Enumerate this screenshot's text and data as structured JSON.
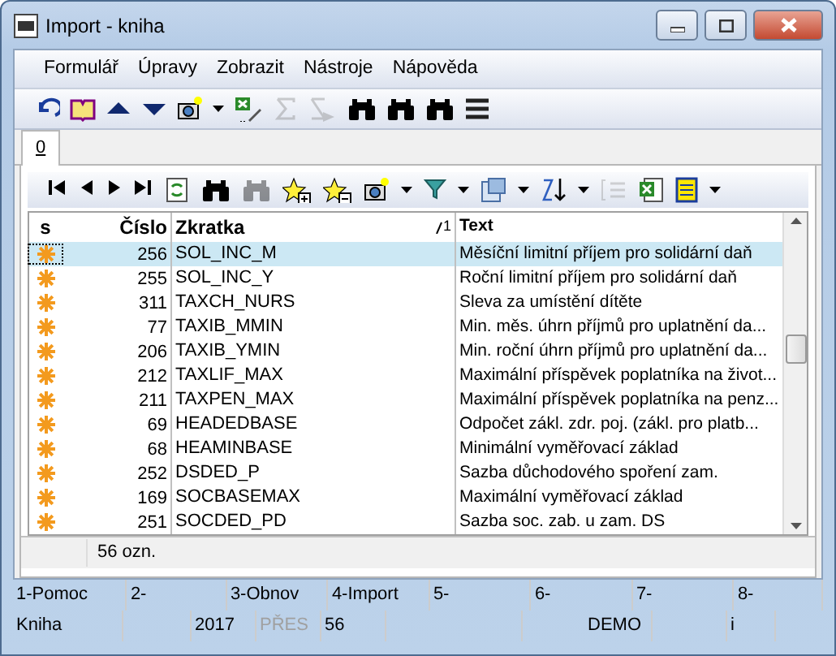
{
  "window": {
    "title": "Import - kniha"
  },
  "menu": [
    {
      "label": "Formulář"
    },
    {
      "label": "Úpravy"
    },
    {
      "label": "Zobrazit"
    },
    {
      "label": "Nástroje"
    },
    {
      "label": "Nápověda"
    }
  ],
  "toolbar": [
    {
      "kind": "undo",
      "disabled": false
    },
    {
      "kind": "book",
      "disabled": false
    },
    {
      "kind": "up",
      "disabled": false
    },
    {
      "kind": "down",
      "disabled": false
    },
    {
      "kind": "camera",
      "disabled": false
    },
    {
      "kind": "caret",
      "disabled": false
    },
    {
      "kind": "excel-pen",
      "disabled": false
    },
    {
      "kind": "sigma",
      "disabled": true
    },
    {
      "kind": "sigma-arrow",
      "disabled": true
    },
    {
      "kind": "binoculars",
      "disabled": false
    },
    {
      "kind": "binoculars",
      "disabled": false
    },
    {
      "kind": "binoculars",
      "disabled": false
    },
    {
      "kind": "lines",
      "disabled": false
    }
  ],
  "tabs": [
    {
      "label": "0",
      "selected": true
    }
  ],
  "grid_toolbar": [
    {
      "kind": "first",
      "disabled": false
    },
    {
      "kind": "prev",
      "disabled": false
    },
    {
      "kind": "next",
      "disabled": false
    },
    {
      "kind": "last",
      "disabled": false
    },
    {
      "kind": "refresh",
      "disabled": false
    },
    {
      "kind": "binoculars",
      "disabled": false
    },
    {
      "kind": "binoculars",
      "disabled": true
    },
    {
      "kind": "star-plus",
      "disabled": false
    },
    {
      "kind": "star-minus",
      "disabled": false
    },
    {
      "kind": "camera",
      "disabled": false
    },
    {
      "kind": "caret",
      "disabled": false
    },
    {
      "kind": "filter",
      "disabled": false
    },
    {
      "kind": "caret",
      "disabled": false
    },
    {
      "kind": "columns",
      "disabled": false
    },
    {
      "kind": "caret",
      "disabled": false
    },
    {
      "kind": "sort",
      "disabled": false
    },
    {
      "kind": "caret",
      "disabled": false
    },
    {
      "kind": "list",
      "disabled": true
    },
    {
      "kind": "excel",
      "disabled": false
    },
    {
      "kind": "table",
      "disabled": false
    },
    {
      "kind": "caret",
      "disabled": false
    }
  ],
  "table": {
    "columns": [
      {
        "label": "s"
      },
      {
        "label": "Číslo"
      },
      {
        "label": "Zkratka",
        "sort_mark": "1"
      },
      {
        "label": "Text"
      }
    ],
    "rows": [
      {
        "selected": true,
        "cells": [
          "",
          "256",
          "SOL_INC_M",
          "Měsíční limitní příjem pro solidární daň"
        ]
      },
      {
        "selected": false,
        "cells": [
          "",
          "255",
          "SOL_INC_Y",
          "Roční limitní příjem pro solidární daň"
        ]
      },
      {
        "selected": false,
        "cells": [
          "",
          "311",
          "TAXCH_NURS",
          "Sleva za umístění dítěte"
        ]
      },
      {
        "selected": false,
        "cells": [
          "",
          "77",
          "TAXIB_MMIN",
          "Min. měs. úhrn příjmů pro uplatnění da..."
        ]
      },
      {
        "selected": false,
        "cells": [
          "",
          "206",
          "TAXIB_YMIN",
          "Min. roční úhrn příjmů pro uplatnění da..."
        ]
      },
      {
        "selected": false,
        "cells": [
          "",
          "212",
          "TAXLIF_MAX",
          "Maximální příspěvek poplatníka na život..."
        ]
      },
      {
        "selected": false,
        "cells": [
          "",
          "211",
          "TAXPEN_MAX",
          "Maximální příspěvek poplatníka na penz..."
        ]
      },
      {
        "selected": false,
        "cells": [
          "",
          "69",
          "HEADEDBASE",
          "Odpočet zákl. zdr. poj. (zákl. pro platb..."
        ]
      },
      {
        "selected": false,
        "cells": [
          "",
          "68",
          "HEAMINBASE",
          "Minimální vyměřovací základ"
        ]
      },
      {
        "selected": false,
        "cells": [
          "",
          "252",
          "DSDED_P",
          "Sazba důchodového spoření zam."
        ]
      },
      {
        "selected": false,
        "cells": [
          "",
          "169",
          "SOCBASEMAX",
          "Maximální vyměřovací základ"
        ]
      },
      {
        "selected": false,
        "cells": [
          "",
          "251",
          "SOCDED_PD",
          "Sazba soc. zab. u zam. DS"
        ]
      }
    ]
  },
  "footer": {
    "count": "56 ozn."
  },
  "function_keys": [
    "1-Pomoc",
    "2-",
    "3-Obnov",
    "4-Import",
    "5-",
    "6-",
    "7-",
    "8-"
  ],
  "status_bar": [
    {
      "text": "Kniha",
      "disabled": false
    },
    {
      "text": "2017",
      "disabled": false
    },
    {
      "text": "PŘES",
      "disabled": true
    },
    {
      "text": "56",
      "disabled": false
    },
    {
      "text": "DEMO",
      "disabled": false
    },
    {
      "text": "i",
      "disabled": false
    }
  ]
}
